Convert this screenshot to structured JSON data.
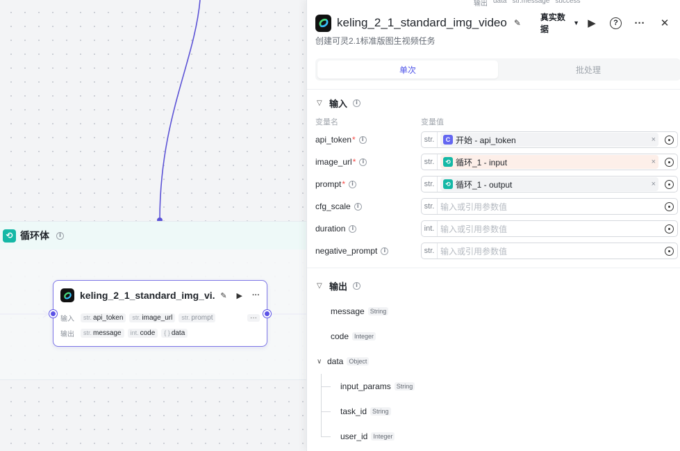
{
  "canvas": {
    "loop": {
      "icon": "loop-icon",
      "title": "循环体"
    },
    "node": {
      "title": "keling_2_1_standard_img_vi...",
      "input_label": "输入",
      "output_label": "输出",
      "inputs": [
        {
          "type": "str.",
          "name": "api_token"
        },
        {
          "type": "str.",
          "name": "image_url"
        },
        {
          "type": "str.",
          "name": "prompt"
        }
      ],
      "more": "···",
      "outputs": [
        {
          "type": "str.",
          "name": "message"
        },
        {
          "type": "int.",
          "name": "code"
        },
        {
          "type": "{ }",
          "name": "data"
        }
      ]
    }
  },
  "panel": {
    "peek": [
      "输出",
      "data",
      "str.message",
      "success"
    ],
    "title": "keling_2_1_standard_img_video",
    "mode": "真实数据",
    "description": "创建可灵2.1标准版图生视频任务",
    "tabs": [
      "单次",
      "批处理"
    ],
    "input_section": "输入",
    "col_name": "变量名",
    "col_value": "变量值",
    "params": [
      {
        "name": "api_token",
        "required": true,
        "type": "str.",
        "ref_source": "开始",
        "ref_field": "api_token",
        "ref_color": "#6366f1",
        "warn": false
      },
      {
        "name": "image_url",
        "required": true,
        "type": "str.",
        "ref_source": "循环_1",
        "ref_field": "input",
        "ref_color": "#14b8a6",
        "warn": true
      },
      {
        "name": "prompt",
        "required": true,
        "type": "str.",
        "ref_source": "循环_1",
        "ref_field": "output",
        "ref_color": "#14b8a6",
        "warn": false
      },
      {
        "name": "cfg_scale",
        "required": false,
        "type": "str.",
        "placeholder": "输入或引用参数值"
      },
      {
        "name": "duration",
        "required": false,
        "type": "int.",
        "placeholder": "输入或引用参数值"
      },
      {
        "name": "negative_prompt",
        "required": false,
        "type": "str.",
        "placeholder": "输入或引用参数值"
      }
    ],
    "output_section": "输出",
    "outputs": [
      {
        "name": "message",
        "type": "String",
        "indent": 0
      },
      {
        "name": "code",
        "type": "Integer",
        "indent": 0
      },
      {
        "name": "data",
        "type": "Object",
        "indent": 0,
        "expandable": true
      },
      {
        "name": "input_params",
        "type": "String",
        "indent": 1
      },
      {
        "name": "task_id",
        "type": "String",
        "indent": 1
      },
      {
        "name": "user_id",
        "type": "Integer",
        "indent": 1
      }
    ]
  }
}
